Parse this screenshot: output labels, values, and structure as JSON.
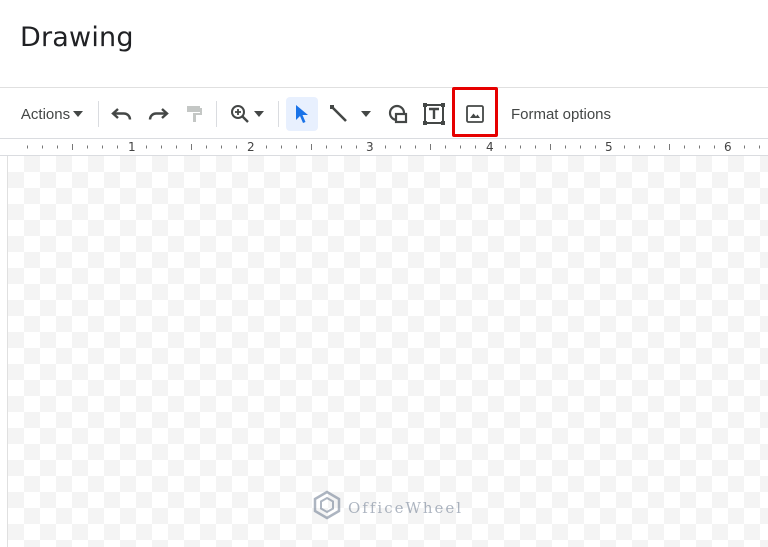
{
  "window": {
    "title": "Drawing"
  },
  "toolbar": {
    "actions_label": "Actions",
    "format_options_label": "Format options",
    "icons": [
      "undo-icon",
      "redo-icon",
      "paint-format-icon",
      "zoom-icon",
      "select-cursor-icon",
      "line-icon",
      "shape-icon",
      "text-box-icon",
      "image-icon"
    ],
    "highlight_color": "#e60000",
    "selected_tool_bg": "#e8f0fe",
    "select_cursor_color": "#1a73e8"
  },
  "ruler": {
    "labels": [
      "1",
      "2",
      "3",
      "4",
      "5",
      "6"
    ]
  },
  "watermark": {
    "text": "OfficeWheel"
  }
}
